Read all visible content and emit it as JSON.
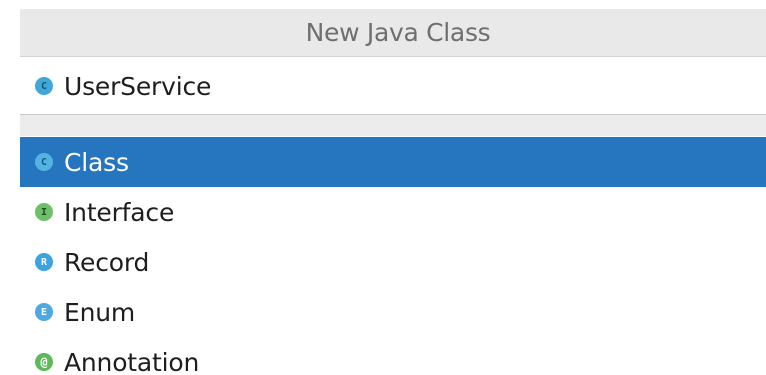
{
  "dialog": {
    "title": "New Java Class",
    "name_field": {
      "icon": "class-icon",
      "icon_letter": "C",
      "value": "UserService"
    },
    "kinds": [
      {
        "label": "Class",
        "icon": "class-icon",
        "letter": "C",
        "selected": true
      },
      {
        "label": "Interface",
        "icon": "interface-icon",
        "letter": "I",
        "selected": false
      },
      {
        "label": "Record",
        "icon": "record-icon",
        "letter": "R",
        "selected": false
      },
      {
        "label": "Enum",
        "icon": "enum-icon",
        "letter": "E",
        "selected": false
      },
      {
        "label": "Annotation",
        "icon": "annotation-icon",
        "letter": "@",
        "selected": false
      }
    ]
  },
  "colors": {
    "selection": "#2675bf",
    "titlebar": "#e9e9e9"
  }
}
